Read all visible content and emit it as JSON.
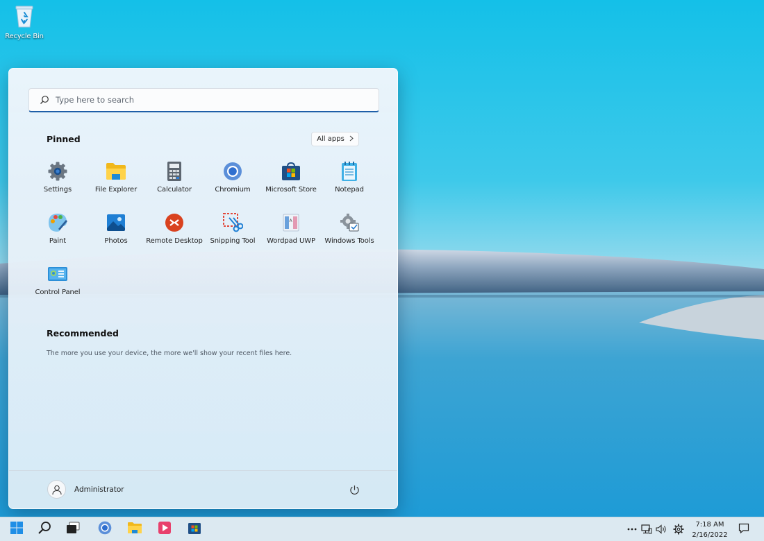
{
  "desktop": {
    "icons": [
      {
        "label": "Recycle Bin",
        "icon": "recycle-bin-icon"
      }
    ]
  },
  "start_menu": {
    "search": {
      "placeholder": "Type here to search",
      "value": ""
    },
    "pinned": {
      "title": "Pinned",
      "all_apps_label": "All apps",
      "apps": [
        {
          "label": "Settings",
          "icon": "gear-icon"
        },
        {
          "label": "File Explorer",
          "icon": "folder-icon"
        },
        {
          "label": "Calculator",
          "icon": "calculator-icon"
        },
        {
          "label": "Chromium",
          "icon": "chromium-icon"
        },
        {
          "label": "Microsoft Store",
          "icon": "store-icon"
        },
        {
          "label": "Notepad",
          "icon": "notepad-icon"
        },
        {
          "label": "Paint",
          "icon": "paint-palette-icon"
        },
        {
          "label": "Photos",
          "icon": "photos-icon"
        },
        {
          "label": "Remote Desktop",
          "icon": "remote-desktop-icon"
        },
        {
          "label": "Snipping Tool",
          "icon": "scissors-icon"
        },
        {
          "label": "Wordpad UWP",
          "icon": "wordpad-icon"
        },
        {
          "label": "Windows Tools",
          "icon": "tools-icon"
        },
        {
          "label": "Control Panel",
          "icon": "control-panel-icon"
        }
      ]
    },
    "recommended": {
      "title": "Recommended",
      "empty_text": "The more you use your device, the more we'll show your recent files here."
    },
    "user": {
      "name": "Administrator",
      "avatar_icon": "user-avatar-icon"
    },
    "power_icon": "power-icon"
  },
  "taskbar": {
    "buttons": [
      {
        "name": "start",
        "icon": "windows-logo-icon"
      },
      {
        "name": "search",
        "icon": "search-icon"
      },
      {
        "name": "task-view",
        "icon": "task-view-icon"
      },
      {
        "name": "chromium",
        "icon": "chromium-icon"
      },
      {
        "name": "file-explorer",
        "icon": "folder-icon"
      },
      {
        "name": "media-player",
        "icon": "media-player-icon"
      },
      {
        "name": "microsoft-store",
        "icon": "store-icon"
      }
    ],
    "tray": {
      "icons": [
        "overflow-dots-icon",
        "network-icon",
        "volume-icon",
        "gear-icon"
      ],
      "time": "7:18 AM",
      "date": "2/16/2022",
      "notification_icon": "notification-icon"
    }
  },
  "colors": {
    "accent": "#1f5fa8",
    "taskbar_bg": "#dce9f1",
    "sky": "#1cc4e6",
    "water": "#3aa0d0"
  }
}
